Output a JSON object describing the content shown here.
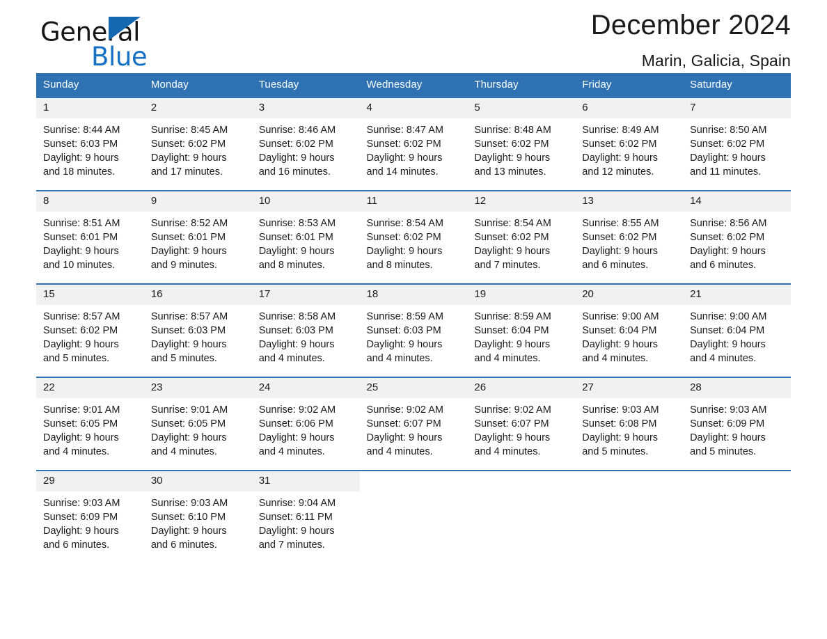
{
  "brand": {
    "name_part1": "General",
    "name_part2": "Blue",
    "triangle_color": "#1567b0",
    "blue_text_color": "#1571c4"
  },
  "header": {
    "title": "December 2024",
    "location": "Marin, Galicia, Spain"
  },
  "theme": {
    "header_blue": "#2f72b3",
    "daynum_band": "#f1f1f1",
    "text": "#1a1a1a"
  },
  "weekdays": [
    "Sunday",
    "Monday",
    "Tuesday",
    "Wednesday",
    "Thursday",
    "Friday",
    "Saturday"
  ],
  "weeks": [
    [
      {
        "day": "1",
        "sunrise": "Sunrise: 8:44 AM",
        "sunset": "Sunset: 6:03 PM",
        "daylight_line1": "Daylight: 9 hours",
        "daylight_line2": "and 18 minutes."
      },
      {
        "day": "2",
        "sunrise": "Sunrise: 8:45 AM",
        "sunset": "Sunset: 6:02 PM",
        "daylight_line1": "Daylight: 9 hours",
        "daylight_line2": "and 17 minutes."
      },
      {
        "day": "3",
        "sunrise": "Sunrise: 8:46 AM",
        "sunset": "Sunset: 6:02 PM",
        "daylight_line1": "Daylight: 9 hours",
        "daylight_line2": "and 16 minutes."
      },
      {
        "day": "4",
        "sunrise": "Sunrise: 8:47 AM",
        "sunset": "Sunset: 6:02 PM",
        "daylight_line1": "Daylight: 9 hours",
        "daylight_line2": "and 14 minutes."
      },
      {
        "day": "5",
        "sunrise": "Sunrise: 8:48 AM",
        "sunset": "Sunset: 6:02 PM",
        "daylight_line1": "Daylight: 9 hours",
        "daylight_line2": "and 13 minutes."
      },
      {
        "day": "6",
        "sunrise": "Sunrise: 8:49 AM",
        "sunset": "Sunset: 6:02 PM",
        "daylight_line1": "Daylight: 9 hours",
        "daylight_line2": "and 12 minutes."
      },
      {
        "day": "7",
        "sunrise": "Sunrise: 8:50 AM",
        "sunset": "Sunset: 6:02 PM",
        "daylight_line1": "Daylight: 9 hours",
        "daylight_line2": "and 11 minutes."
      }
    ],
    [
      {
        "day": "8",
        "sunrise": "Sunrise: 8:51 AM",
        "sunset": "Sunset: 6:01 PM",
        "daylight_line1": "Daylight: 9 hours",
        "daylight_line2": "and 10 minutes."
      },
      {
        "day": "9",
        "sunrise": "Sunrise: 8:52 AM",
        "sunset": "Sunset: 6:01 PM",
        "daylight_line1": "Daylight: 9 hours",
        "daylight_line2": "and 9 minutes."
      },
      {
        "day": "10",
        "sunrise": "Sunrise: 8:53 AM",
        "sunset": "Sunset: 6:01 PM",
        "daylight_line1": "Daylight: 9 hours",
        "daylight_line2": "and 8 minutes."
      },
      {
        "day": "11",
        "sunrise": "Sunrise: 8:54 AM",
        "sunset": "Sunset: 6:02 PM",
        "daylight_line1": "Daylight: 9 hours",
        "daylight_line2": "and 8 minutes."
      },
      {
        "day": "12",
        "sunrise": "Sunrise: 8:54 AM",
        "sunset": "Sunset: 6:02 PM",
        "daylight_line1": "Daylight: 9 hours",
        "daylight_line2": "and 7 minutes."
      },
      {
        "day": "13",
        "sunrise": "Sunrise: 8:55 AM",
        "sunset": "Sunset: 6:02 PM",
        "daylight_line1": "Daylight: 9 hours",
        "daylight_line2": "and 6 minutes."
      },
      {
        "day": "14",
        "sunrise": "Sunrise: 8:56 AM",
        "sunset": "Sunset: 6:02 PM",
        "daylight_line1": "Daylight: 9 hours",
        "daylight_line2": "and 6 minutes."
      }
    ],
    [
      {
        "day": "15",
        "sunrise": "Sunrise: 8:57 AM",
        "sunset": "Sunset: 6:02 PM",
        "daylight_line1": "Daylight: 9 hours",
        "daylight_line2": "and 5 minutes."
      },
      {
        "day": "16",
        "sunrise": "Sunrise: 8:57 AM",
        "sunset": "Sunset: 6:03 PM",
        "daylight_line1": "Daylight: 9 hours",
        "daylight_line2": "and 5 minutes."
      },
      {
        "day": "17",
        "sunrise": "Sunrise: 8:58 AM",
        "sunset": "Sunset: 6:03 PM",
        "daylight_line1": "Daylight: 9 hours",
        "daylight_line2": "and 4 minutes."
      },
      {
        "day": "18",
        "sunrise": "Sunrise: 8:59 AM",
        "sunset": "Sunset: 6:03 PM",
        "daylight_line1": "Daylight: 9 hours",
        "daylight_line2": "and 4 minutes."
      },
      {
        "day": "19",
        "sunrise": "Sunrise: 8:59 AM",
        "sunset": "Sunset: 6:04 PM",
        "daylight_line1": "Daylight: 9 hours",
        "daylight_line2": "and 4 minutes."
      },
      {
        "day": "20",
        "sunrise": "Sunrise: 9:00 AM",
        "sunset": "Sunset: 6:04 PM",
        "daylight_line1": "Daylight: 9 hours",
        "daylight_line2": "and 4 minutes."
      },
      {
        "day": "21",
        "sunrise": "Sunrise: 9:00 AM",
        "sunset": "Sunset: 6:04 PM",
        "daylight_line1": "Daylight: 9 hours",
        "daylight_line2": "and 4 minutes."
      }
    ],
    [
      {
        "day": "22",
        "sunrise": "Sunrise: 9:01 AM",
        "sunset": "Sunset: 6:05 PM",
        "daylight_line1": "Daylight: 9 hours",
        "daylight_line2": "and 4 minutes."
      },
      {
        "day": "23",
        "sunrise": "Sunrise: 9:01 AM",
        "sunset": "Sunset: 6:05 PM",
        "daylight_line1": "Daylight: 9 hours",
        "daylight_line2": "and 4 minutes."
      },
      {
        "day": "24",
        "sunrise": "Sunrise: 9:02 AM",
        "sunset": "Sunset: 6:06 PM",
        "daylight_line1": "Daylight: 9 hours",
        "daylight_line2": "and 4 minutes."
      },
      {
        "day": "25",
        "sunrise": "Sunrise: 9:02 AM",
        "sunset": "Sunset: 6:07 PM",
        "daylight_line1": "Daylight: 9 hours",
        "daylight_line2": "and 4 minutes."
      },
      {
        "day": "26",
        "sunrise": "Sunrise: 9:02 AM",
        "sunset": "Sunset: 6:07 PM",
        "daylight_line1": "Daylight: 9 hours",
        "daylight_line2": "and 4 minutes."
      },
      {
        "day": "27",
        "sunrise": "Sunrise: 9:03 AM",
        "sunset": "Sunset: 6:08 PM",
        "daylight_line1": "Daylight: 9 hours",
        "daylight_line2": "and 5 minutes."
      },
      {
        "day": "28",
        "sunrise": "Sunrise: 9:03 AM",
        "sunset": "Sunset: 6:09 PM",
        "daylight_line1": "Daylight: 9 hours",
        "daylight_line2": "and 5 minutes."
      }
    ],
    [
      {
        "day": "29",
        "sunrise": "Sunrise: 9:03 AM",
        "sunset": "Sunset: 6:09 PM",
        "daylight_line1": "Daylight: 9 hours",
        "daylight_line2": "and 6 minutes."
      },
      {
        "day": "30",
        "sunrise": "Sunrise: 9:03 AM",
        "sunset": "Sunset: 6:10 PM",
        "daylight_line1": "Daylight: 9 hours",
        "daylight_line2": "and 6 minutes."
      },
      {
        "day": "31",
        "sunrise": "Sunrise: 9:04 AM",
        "sunset": "Sunset: 6:11 PM",
        "daylight_line1": "Daylight: 9 hours",
        "daylight_line2": "and 7 minutes."
      },
      {
        "day": "",
        "sunrise": "",
        "sunset": "",
        "daylight_line1": "",
        "daylight_line2": ""
      },
      {
        "day": "",
        "sunrise": "",
        "sunset": "",
        "daylight_line1": "",
        "daylight_line2": ""
      },
      {
        "day": "",
        "sunrise": "",
        "sunset": "",
        "daylight_line1": "",
        "daylight_line2": ""
      },
      {
        "day": "",
        "sunrise": "",
        "sunset": "",
        "daylight_line1": "",
        "daylight_line2": ""
      }
    ]
  ]
}
